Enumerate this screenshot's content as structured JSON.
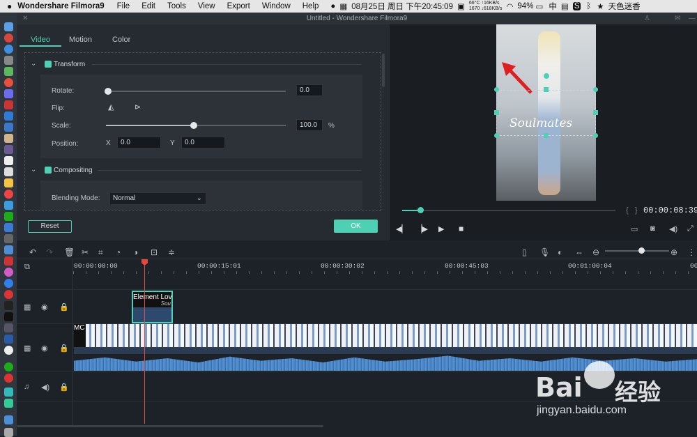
{
  "menubar": {
    "app": "Wondershare Filmora9",
    "items": [
      "File",
      "Edit",
      "Tools",
      "View",
      "Export",
      "Window",
      "Help"
    ],
    "temp": "66°C",
    "cpu": "1670",
    "net_up": "↑16KB/s",
    "net_down": "↓618KB/s",
    "datetime": "08月25日 周日 下午20:45:09",
    "battery": "94%",
    "ime": "天色迷香"
  },
  "window": {
    "title": "Untitled - Wondershare Filmora9"
  },
  "editor": {
    "tabs": [
      "Video",
      "Motion",
      "Color"
    ],
    "active_tab": "Video",
    "transform": {
      "label": "Transform",
      "rotate_label": "Rotate:",
      "rotate_value": "0.0",
      "flip_label": "Flip:",
      "scale_label": "Scale:",
      "scale_value": "100.0",
      "scale_unit": "%",
      "position_label": "Position:",
      "x_label": "X",
      "x_value": "0.0",
      "y_label": "Y",
      "y_value": "0.0"
    },
    "compositing": {
      "label": "Compositing",
      "blend_label": "Blending Mode:",
      "blend_value": "Normal"
    },
    "reset_label": "Reset",
    "ok_label": "OK"
  },
  "preview": {
    "timecode": "00:00:08:39",
    "overlay_text": "Soulmates",
    "progress": 0.06
  },
  "timeline": {
    "ruler": [
      "00:00:00:00",
      "00:00:15:01",
      "00:00:30:02",
      "00:00:45:03",
      "00:01:00:04",
      "00"
    ],
    "clips": {
      "title_clip": "Element Lov",
      "title_sub": "Sou",
      "video_clip": "MC"
    }
  },
  "watermark": {
    "brand": "Bai",
    "brand2": "经验",
    "url": "jingyan.baidu.com"
  },
  "colors": {
    "accent": "#4dd0b4",
    "playhead": "#e8473f",
    "audio": "#4a86c8"
  }
}
